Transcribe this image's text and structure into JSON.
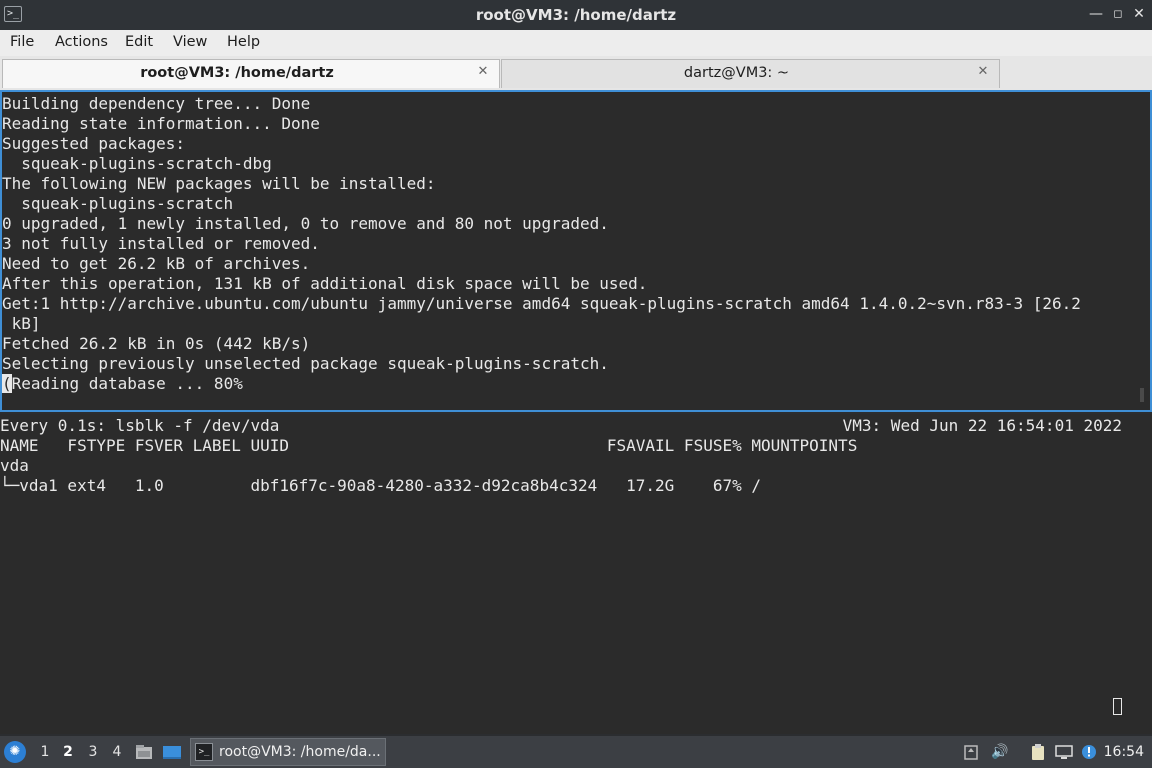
{
  "window": {
    "title": "root@VM3: /home/dartz"
  },
  "menu": {
    "items": [
      "File",
      "Actions",
      "Edit",
      "View",
      "Help"
    ]
  },
  "tabs": [
    {
      "label": "root@VM3: /home/dartz",
      "active": true
    },
    {
      "label": "dartz@VM3: ~",
      "active": false
    }
  ],
  "top_pane": {
    "lines": [
      "Building dependency tree... Done",
      "Reading state information... Done",
      "Suggested packages:",
      "  squeak-plugins-scratch-dbg",
      "The following NEW packages will be installed:",
      "  squeak-plugins-scratch",
      "0 upgraded, 1 newly installed, 0 to remove and 80 not upgraded.",
      "3 not fully installed or removed.",
      "Need to get 26.2 kB of archives.",
      "After this operation, 131 kB of additional disk space will be used.",
      "Get:1 http://archive.ubuntu.com/ubuntu jammy/universe amd64 squeak-plugins-scratch amd64 1.4.0.2~svn.r83-3 [26.2",
      " kB]",
      "Fetched 26.2 kB in 0s (442 kB/s)",
      "Selecting previously unselected package squeak-plugins-scratch."
    ],
    "cursor_char": "(",
    "last_line_rest": "Reading database ... 80%"
  },
  "bottom_pane": {
    "header_left": "Every 0.1s: lsblk -f /dev/vda",
    "header_right": "VM3: Wed Jun 22 16:54:01 2022",
    "lines": [
      "",
      "NAME   FSTYPE FSVER LABEL UUID                                 FSAVAIL FSUSE% MOUNTPOINTS",
      "vda",
      "└─vda1 ext4   1.0         dbf16f7c-90a8-4280-a332-d92ca8b4c324   17.2G    67% /"
    ]
  },
  "taskbar": {
    "workspaces": [
      "1",
      "2",
      "3",
      "4"
    ],
    "current_workspace": "2",
    "task_label": "root@VM3: /home/da...",
    "clock": "16:54"
  }
}
